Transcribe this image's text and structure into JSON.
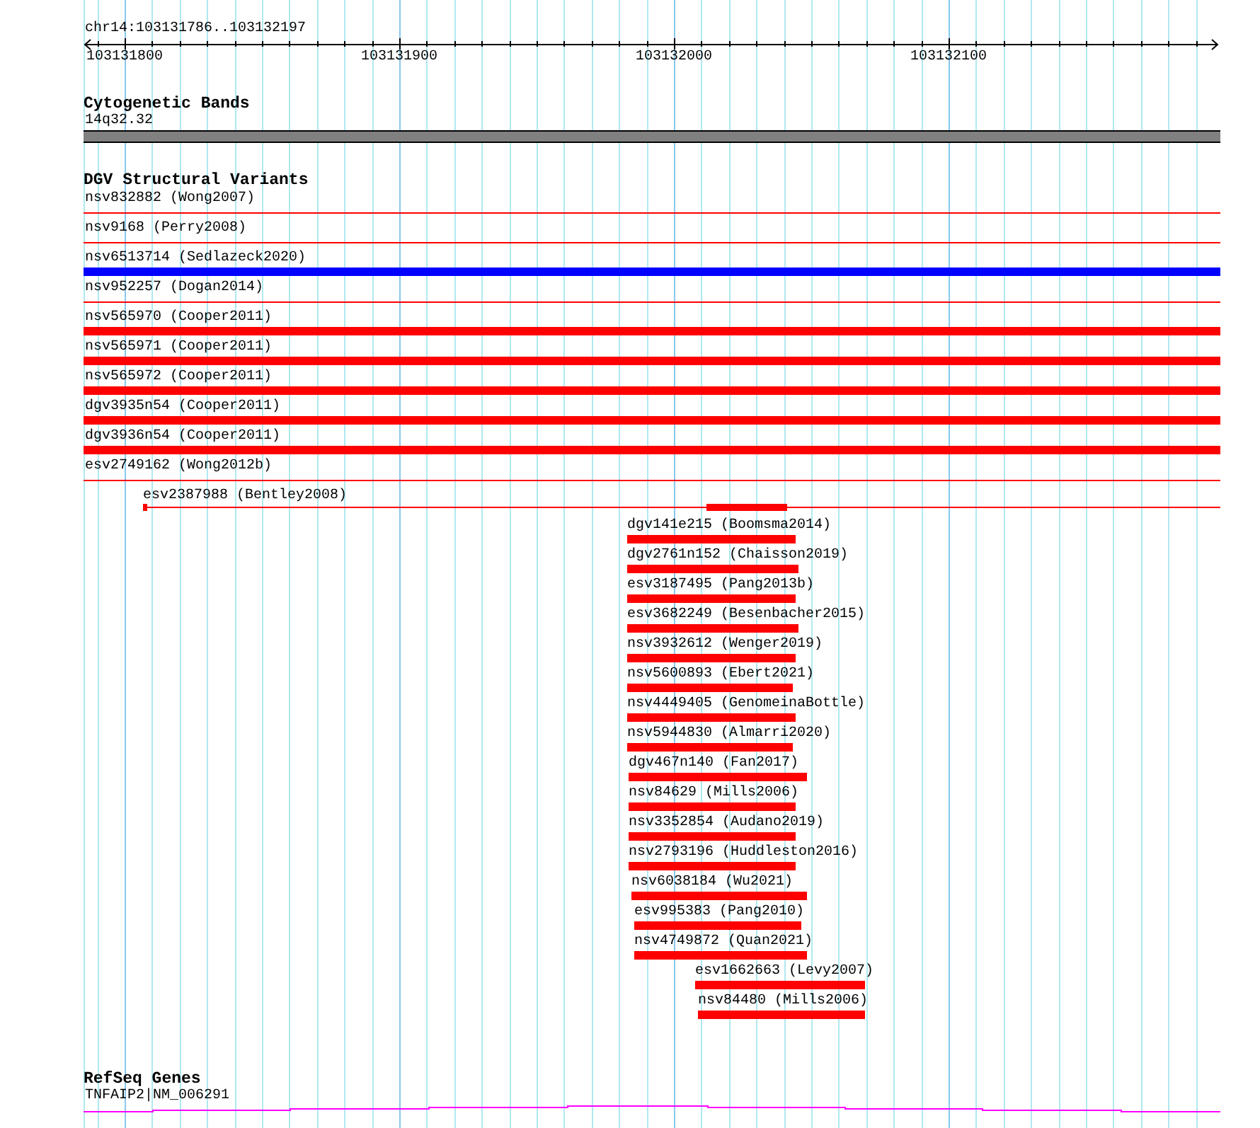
{
  "ruler": {
    "title": "chr14:103131786..103132197",
    "ticks": [
      "103131800",
      "103131900",
      "103132000",
      "103132100"
    ]
  },
  "cytogenetic_bands": {
    "title": "Cytogenetic Bands",
    "band": "14q32.32"
  },
  "dgv": {
    "title": "DGV Structural Variants",
    "variants": [
      {
        "label": "nsv832882 (Wong2007)",
        "kind": "line",
        "color": "#ff0000"
      },
      {
        "label": "nsv9168 (Perry2008)",
        "kind": "line",
        "color": "#ff0000"
      },
      {
        "label": "nsv6513714 (Sedlazeck2020)",
        "kind": "bar",
        "color": "#0000ff"
      },
      {
        "label": "nsv952257 (Dogan2014)",
        "kind": "line",
        "color": "#ff0000"
      },
      {
        "label": "nsv565970 (Cooper2011)",
        "kind": "bar",
        "color": "#ff0000"
      },
      {
        "label": "nsv565971 (Cooper2011)",
        "kind": "bar",
        "color": "#ff0000"
      },
      {
        "label": "nsv565972 (Cooper2011)",
        "kind": "bar",
        "color": "#ff0000"
      },
      {
        "label": "dgv3935n54 (Cooper2011)",
        "kind": "bar",
        "color": "#ff0000"
      },
      {
        "label": "dgv3936n54 (Cooper2011)",
        "kind": "bar",
        "color": "#ff0000"
      },
      {
        "label": "esv2749162 (Wong2012b)",
        "kind": "line",
        "color": "#ff0000"
      },
      {
        "label": "esv2387988 (Bentley2008)",
        "kind": "capped-line",
        "color": "#ff0000"
      },
      {
        "label": "dgv141e215 (Boomsma2014)",
        "kind": "bar",
        "color": "#ff0000"
      },
      {
        "label": "dgv2761n152 (Chaisson2019)",
        "kind": "bar",
        "color": "#ff0000"
      },
      {
        "label": "esv3187495 (Pang2013b)",
        "kind": "bar",
        "color": "#ff0000"
      },
      {
        "label": "esv3682249 (Besenbacher2015)",
        "kind": "bar",
        "color": "#ff0000"
      },
      {
        "label": "nsv3932612 (Wenger2019)",
        "kind": "bar",
        "color": "#ff0000"
      },
      {
        "label": "nsv5600893 (Ebert2021)",
        "kind": "bar",
        "color": "#ff0000"
      },
      {
        "label": "nsv4449405 (GenomeinaBottle)",
        "kind": "bar",
        "color": "#ff0000"
      },
      {
        "label": "nsv5944830 (Almarri2020)",
        "kind": "bar",
        "color": "#ff0000"
      },
      {
        "label": "dgv467n140 (Fan2017)",
        "kind": "bar",
        "color": "#ff0000"
      },
      {
        "label": "nsv84629 (Mills2006)",
        "kind": "bar",
        "color": "#ff0000"
      },
      {
        "label": "nsv3352854 (Audano2019)",
        "kind": "bar",
        "color": "#ff0000"
      },
      {
        "label": "nsv2793196 (Huddleston2016)",
        "kind": "bar",
        "color": "#ff0000"
      },
      {
        "label": "nsv6038184 (Wu2021)",
        "kind": "bar",
        "color": "#ff0000"
      },
      {
        "label": "esv995383 (Pang2010)",
        "kind": "bar",
        "color": "#ff0000"
      },
      {
        "label": "nsv4749872 (Quan2021)",
        "kind": "bar",
        "color": "#ff0000"
      },
      {
        "label": "esv1662663 (Levy2007)",
        "kind": "bar",
        "color": "#ff0000"
      },
      {
        "label": "nsv84480 (Mills2006)",
        "kind": "bar",
        "color": "#ff0000"
      }
    ]
  },
  "refseq": {
    "title": "RefSeq Genes",
    "gene": "TNFAIP2|NM_006291"
  }
}
